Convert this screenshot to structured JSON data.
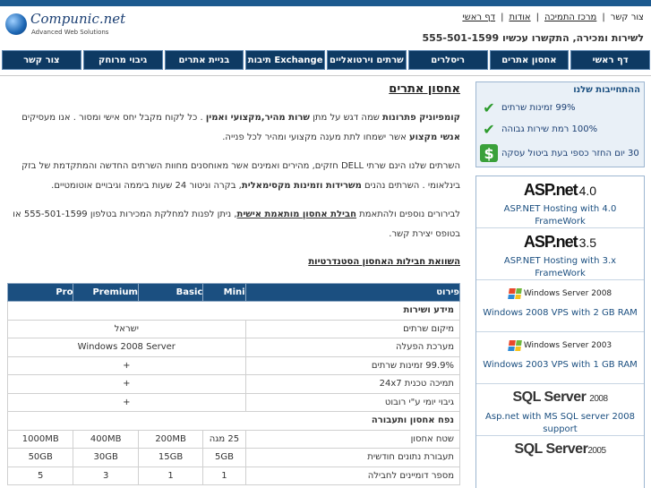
{
  "header": {
    "logo_name": "Compunic.net",
    "logo_tagline": "Advanced Web Solutions",
    "links": [
      "צור קשר",
      "מרכז התמיכה",
      "אודות",
      "דף ראשי"
    ],
    "phone": "לשירות ומכירה, התקשרו עכשיו 555-501-1599"
  },
  "nav": [
    "דף ראשי",
    "אחסון אתרים",
    "ריסלרים",
    "שרתים וירטואליים",
    "תיבות Exchange",
    "בניית אתרים",
    "גיבוי מרוחק",
    "צור קשר"
  ],
  "main": {
    "title": "אחסון אתרים",
    "p1_a": "קומפיוניק פתרונות",
    "p1_b": " שמה  דגש על מתן ",
    "p1_c": "שרות מהיר,מקצועי ואמין",
    "p1_d": " . כל לקוח מקבל יחס אישי ומסור . אנו מעסיקים ",
    "p1_e": "אנשי מקצוע",
    "p1_f": "  אשר ישמחו לתת מענה מקצועי ומהיר לכל פנייה.",
    "p2_a": "השרתים שלנו הינם שרתי DELL חזקים, מהירים ואמינים אשר מאוחסנים מחוות השרתים החדשה והמתקדמת של בזק בינלאומי .  השרתים נהנים ",
    "p2_b": "משרידות וזמינות מקסימאלית",
    "p2_c": ", בקרה וניטור 24 שעות ביממה וגיבויים אוטומטיים.",
    "p3_a": "לבירורים נוספים ולהתאמת ",
    "p3_b": "חבילת אחסון מותאמת אישית",
    "p3_c": ", ניתן לפנות למחלקת המכירות בטלפון 555-501-1599 או בטופס יצירת קשר.",
    "compare_title": "השוואת חבילות האחסון הסטנדרטיות"
  },
  "table": {
    "headers": [
      "פירוט",
      "Mini",
      "Basic",
      "Premium",
      "Pro"
    ],
    "sections": [
      {
        "title": "מידע ושירות",
        "rows": [
          {
            "feature": "מיקום שרתים",
            "span": "ישראל"
          },
          {
            "feature": "מערכת הפעלה",
            "span": "Windows 2008 Server"
          },
          {
            "feature": "99.9% זמינות שרתים",
            "span": "+"
          },
          {
            "feature": "תמיכה טכנית 24x7",
            "span": "+"
          },
          {
            "feature": "גיבוי יומי ע\"י רובוט",
            "span": "+"
          }
        ]
      },
      {
        "title": "נפח אחסון ותעבורה",
        "rows": [
          {
            "feature": "שטח אחסון",
            "values": [
              "25 מגה",
              "200MB",
              "400MB",
              "1000MB"
            ]
          },
          {
            "feature": "תעבורת נתונים חודשית",
            "values": [
              "5GB",
              "15GB",
              "30GB",
              "50GB"
            ]
          },
          {
            "feature": "מספר דומיינים לחבילה",
            "values": [
              "1",
              "1",
              "3",
              "5"
            ]
          }
        ]
      }
    ]
  },
  "sidebar": {
    "heading": "ההתחייבות שלנו",
    "items": [
      {
        "icon": "check-icon",
        "label": "99% זמינות שרתים"
      },
      {
        "icon": "check-icon",
        "label": "100% רמת שירות גבוהה"
      },
      {
        "icon": "dollar-icon",
        "label": "30 יום החזר כספי בעת ביטול עסקה"
      }
    ]
  },
  "ads": [
    {
      "logo": "ASP.net",
      "version": "4.0",
      "text": "ASP.NET Hosting with 4.0 FrameWork"
    },
    {
      "logo": "ASP.net",
      "version": "3.5",
      "text": "ASP.NET Hosting with 3.x FrameWork"
    },
    {
      "logo": "Windows Server 2008",
      "text": "Windows 2008 VPS with 2 GB RAM"
    },
    {
      "logo": "Windows Server 2003",
      "text": "Windows 2003 VPS with 1 GB RAM"
    },
    {
      "logo": "SQL Server",
      "version": "2008",
      "text": "Asp.net with MS SQL server 2008 support"
    },
    {
      "logo": "SQL Server",
      "version": "2005",
      "text": ""
    }
  ]
}
